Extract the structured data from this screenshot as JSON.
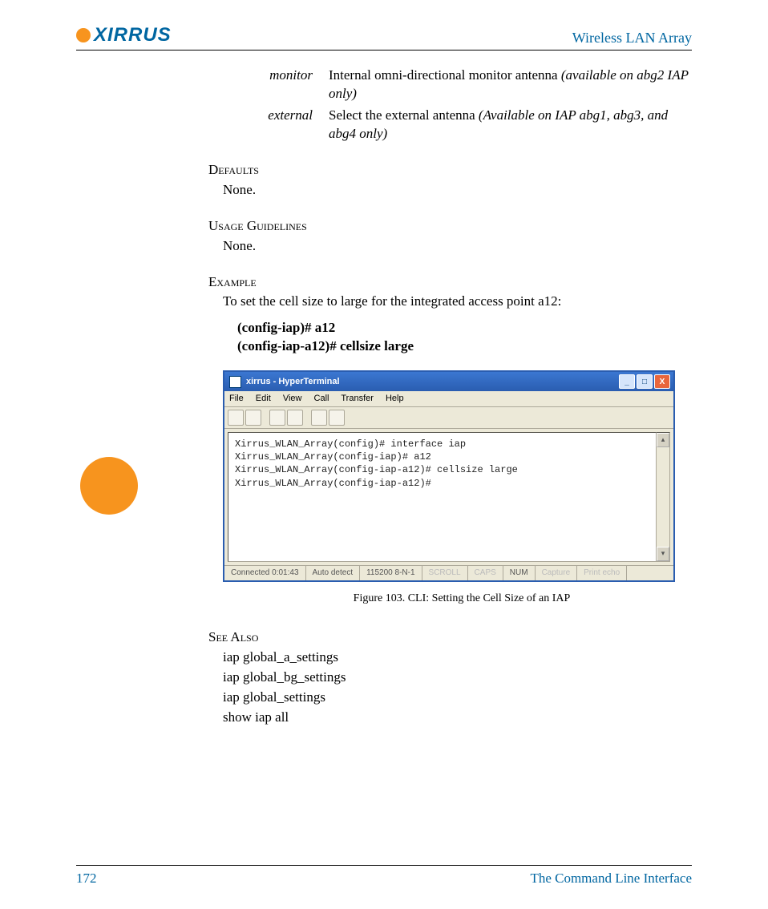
{
  "header": {
    "logo_text": "XIRRUS",
    "title": "Wireless LAN Array"
  },
  "params": {
    "monitor": {
      "term": "monitor",
      "desc_main": "Internal omni-directional monitor antenna ",
      "desc_italic": "(available on abg2 IAP only)"
    },
    "external": {
      "term": "external",
      "desc_main": "Select the external antenna ",
      "desc_italic": "(Available on IAP abg1, abg3, and abg4 only)"
    }
  },
  "sections": {
    "defaults_h": "Defaults",
    "defaults_body": "None.",
    "usage_h": "Usage Guidelines",
    "usage_body": "None.",
    "example_h": "Example",
    "example_intro": "To set the cell size to large for the integrated access point a12:",
    "example_cmd1": "(config-iap)# a12",
    "example_cmd2": "(config-iap-a12)# cellsize large",
    "seealso_h": "See Also",
    "seealso_items": [
      "iap global_a_settings",
      "iap global_bg_settings",
      "iap global_settings",
      "show iap all"
    ]
  },
  "hyperterminal": {
    "title": "xirrus - HyperTerminal",
    "menu": [
      "File",
      "Edit",
      "View",
      "Call",
      "Transfer",
      "Help"
    ],
    "terminal_lines": "Xirrus_WLAN_Array(config)# interface iap\nXirrus_WLAN_Array(config-iap)# a12\nXirrus_WLAN_Array(config-iap-a12)# cellsize large\nXirrus_WLAN_Array(config-iap-a12)#",
    "status": {
      "connected": "Connected 0:01:43",
      "detect": "Auto detect",
      "baud": "115200 8-N-1",
      "scroll": "SCROLL",
      "caps": "CAPS",
      "num": "NUM",
      "capture": "Capture",
      "print": "Print echo"
    }
  },
  "figure_caption": "Figure 103. CLI: Setting the Cell Size of an IAP",
  "footer": {
    "page": "172",
    "section": "The Command Line Interface"
  }
}
